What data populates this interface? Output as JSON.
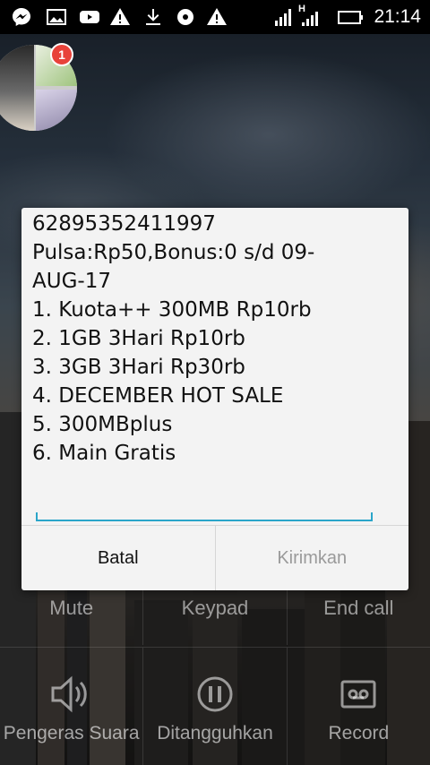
{
  "status_bar": {
    "time": "21:14",
    "network_type": "H",
    "icons": [
      "messenger-icon",
      "gallery-icon",
      "youtube-icon",
      "warning-icon",
      "download-icon",
      "disc-icon",
      "warning-icon",
      "signal-icon",
      "battery-icon"
    ]
  },
  "notification_badge": {
    "count": "1"
  },
  "ussd_dialog": {
    "lines": [
      "62895352411997",
      "Pulsa:Rp50,Bonus:0 s/d 09-",
      "AUG-17",
      "1. Kuota++ 300MB Rp10rb",
      "2. 1GB 3Hari Rp10rb",
      "3. 3GB 3Hari Rp30rb",
      "4. DECEMBER HOT SALE",
      "5. 300MBplus",
      "6. Main Gratis"
    ],
    "input_value": "",
    "cancel_label": "Batal",
    "send_label": "Kirimkan"
  },
  "call_controls": {
    "row1": [
      "Mute",
      "Keypad",
      "End call"
    ],
    "row2": [
      {
        "label": "Pengeras Suara",
        "icon": "speaker-icon"
      },
      {
        "label": "Ditangguhkan",
        "icon": "pause-icon"
      },
      {
        "label": "Record",
        "icon": "record-icon"
      }
    ]
  },
  "colors": {
    "accent": "#2aa5c9",
    "badge": "#e8423a",
    "dialog_bg": "#f3f3f3",
    "disabled_text": "#9a9a9a"
  }
}
